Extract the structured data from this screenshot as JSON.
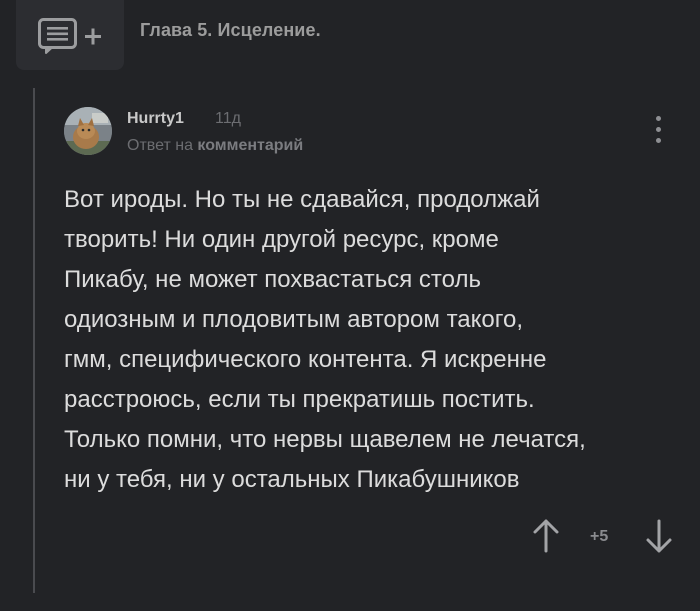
{
  "post": {
    "title": "Глава 5. Исцеление."
  },
  "comment": {
    "username": "Hurrty1",
    "time": "11д",
    "reply_prefix": "Ответ на",
    "reply_target": "комментарий",
    "text_lines": [
      "Вот ироды. Но ты не сдавайся, продолжай",
      "творить! Ни один другой ресурс, кроме",
      "Пикабу, не может похвастаться столь",
      "одиозным и плодовитым автором такого,",
      "гмм, специфического контента. Я искренне",
      "расстроюсь, если ты прекратишь постить.",
      "Только помни, что нервы щавелем не лечатся,",
      "ни у тебя, ни у остальных Пикабушников"
    ],
    "rating": "+5"
  },
  "icons": {
    "add_comment": "comment-plus-icon",
    "more": "more-vertical-icon",
    "vote_up": "arrow-up-icon",
    "vote_down": "arrow-down-icon"
  }
}
